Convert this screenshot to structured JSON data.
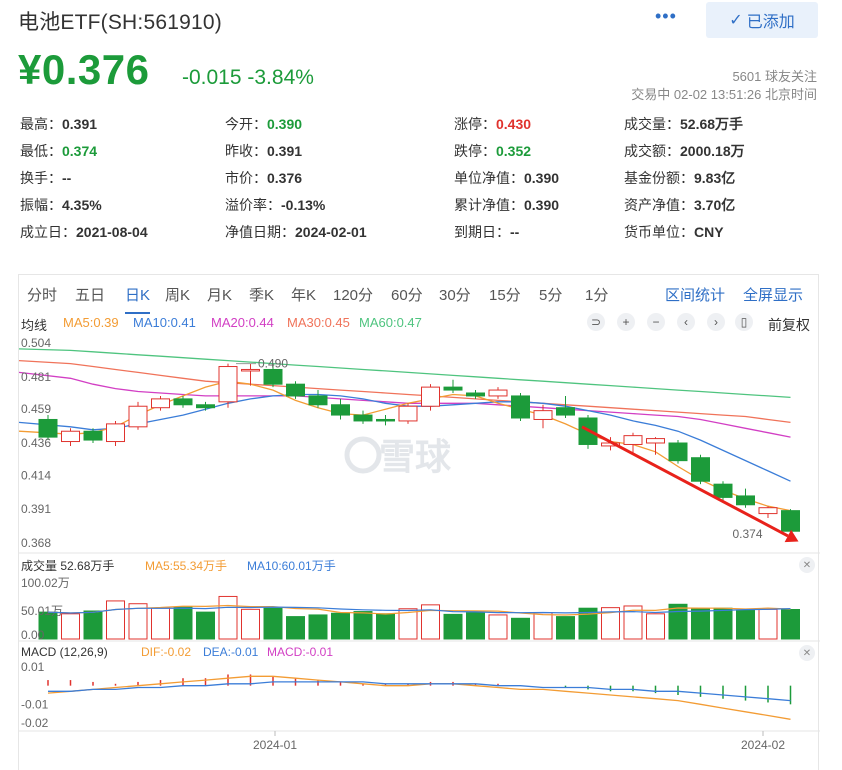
{
  "header": {
    "title": "电池ETF(SH:561910)",
    "more": "•••",
    "follow_label": "已添加",
    "price": "¥0.376",
    "change": "-0.015  -3.84%",
    "followers": "5601 球友关注",
    "status": "交易中 02-02 13:51:26 北京时间"
  },
  "stats": [
    [
      {
        "label": "最高：",
        "value": "0.391",
        "color": ""
      },
      {
        "label": "今开：",
        "value": "0.390",
        "color": "green"
      },
      {
        "label": "涨停：",
        "value": "0.430",
        "color": "red"
      },
      {
        "label": "成交量：",
        "value": "52.68万手",
        "color": ""
      }
    ],
    [
      {
        "label": "最低：",
        "value": "0.374",
        "color": "green"
      },
      {
        "label": "昨收：",
        "value": "0.391",
        "color": ""
      },
      {
        "label": "跌停：",
        "value": "0.352",
        "color": "green"
      },
      {
        "label": "成交额：",
        "value": "2000.18万",
        "color": ""
      }
    ],
    [
      {
        "label": "换手：",
        "value": "--",
        "color": ""
      },
      {
        "label": "市价：",
        "value": "0.376",
        "color": ""
      },
      {
        "label": "单位净值：",
        "value": "0.390",
        "color": ""
      },
      {
        "label": "基金份额：",
        "value": "9.83亿",
        "color": ""
      }
    ],
    [
      {
        "label": "振幅：",
        "value": "4.35%",
        "color": ""
      },
      {
        "label": "溢价率：",
        "value": "-0.13%",
        "color": ""
      },
      {
        "label": "累计净值：",
        "value": "0.390",
        "color": ""
      },
      {
        "label": "资产净值：",
        "value": "3.70亿",
        "color": ""
      }
    ],
    [
      {
        "label": "成立日：",
        "value": "2021-08-04",
        "color": ""
      },
      {
        "label": "净值日期：",
        "value": "2024-02-01",
        "color": ""
      },
      {
        "label": "到期日：",
        "value": "--",
        "color": ""
      },
      {
        "label": "货币单位：",
        "value": "CNY",
        "color": ""
      }
    ]
  ],
  "tabs": [
    "分时",
    "五日",
    "日K",
    "周K",
    "月K",
    "季K",
    "年K",
    "120分",
    "60分",
    "30分",
    "15分",
    "5分",
    "1分"
  ],
  "tab_right": [
    "区间统计",
    "全屏显示"
  ],
  "ma_legend": {
    "label": "均线",
    "items": [
      {
        "text": "MA5:0.39",
        "color": "#f39c34"
      },
      {
        "text": "MA10:0.41",
        "color": "#3b7dd8"
      },
      {
        "text": "MA20:0.44",
        "color": "#d23fc4"
      },
      {
        "text": "MA30:0.45",
        "color": "#f0735a"
      },
      {
        "text": "MA60:0.47",
        "color": "#4fc47f"
      }
    ],
    "controls": [
      "⊃",
      "+",
      "−",
      "‹",
      "›",
      "▯"
    ],
    "fq": "前复权"
  },
  "watermark": "雪球",
  "volume_legend": {
    "label": "成交量 52.68万手",
    "ma5": "MA5:55.34万手",
    "ma10": "MA10:60.01万手",
    "top_tick": "100.02万",
    "mid_tick": "50.01万",
    "zero_tick": "0.00"
  },
  "macd_legend": {
    "label": "MACD (12,26,9)",
    "dif": "DIF:-0.02",
    "dea": "DEA:-0.01",
    "macd": "MACD:-0.01",
    "ticks": [
      "0.01",
      "-0.01",
      "-0.02"
    ]
  },
  "colors": {
    "up": "#e0332e",
    "down": "#1c9b3a",
    "arrow": "#e8221b"
  },
  "chart_data": {
    "type": "candlestick",
    "price_axis": {
      "ticks": [
        "0.504",
        "0.481",
        "0.459",
        "0.436",
        "0.414",
        "0.391",
        "0.368"
      ],
      "ylim": [
        0.368,
        0.504
      ]
    },
    "annotations": {
      "high": "0.490",
      "low": "0.374"
    },
    "x_labels": [
      "2024-01",
      "2024-02"
    ],
    "candles": [
      {
        "o": 0.452,
        "c": 0.44,
        "h": 0.455,
        "l": 0.438
      },
      {
        "o": 0.437,
        "c": 0.444,
        "h": 0.446,
        "l": 0.434
      },
      {
        "o": 0.444,
        "c": 0.438,
        "h": 0.446,
        "l": 0.436
      },
      {
        "o": 0.437,
        "c": 0.449,
        "h": 0.451,
        "l": 0.434
      },
      {
        "o": 0.447,
        "c": 0.461,
        "h": 0.464,
        "l": 0.445
      },
      {
        "o": 0.46,
        "c": 0.466,
        "h": 0.468,
        "l": 0.458
      },
      {
        "o": 0.466,
        "c": 0.462,
        "h": 0.468,
        "l": 0.46
      },
      {
        "o": 0.462,
        "c": 0.46,
        "h": 0.464,
        "l": 0.458
      },
      {
        "o": 0.464,
        "c": 0.488,
        "h": 0.49,
        "l": 0.46
      },
      {
        "o": 0.485,
        "c": 0.486,
        "h": 0.49,
        "l": 0.475
      },
      {
        "o": 0.486,
        "c": 0.476,
        "h": 0.49,
        "l": 0.474
      },
      {
        "o": 0.476,
        "c": 0.468,
        "h": 0.478,
        "l": 0.466
      },
      {
        "o": 0.468,
        "c": 0.462,
        "h": 0.472,
        "l": 0.46
      },
      {
        "o": 0.462,
        "c": 0.455,
        "h": 0.466,
        "l": 0.452
      },
      {
        "o": 0.455,
        "c": 0.451,
        "h": 0.458,
        "l": 0.449
      },
      {
        "o": 0.452,
        "c": 0.451,
        "h": 0.455,
        "l": 0.448
      },
      {
        "o": 0.451,
        "c": 0.461,
        "h": 0.463,
        "l": 0.449
      },
      {
        "o": 0.461,
        "c": 0.474,
        "h": 0.476,
        "l": 0.458
      },
      {
        "o": 0.474,
        "c": 0.472,
        "h": 0.479,
        "l": 0.47
      },
      {
        "o": 0.47,
        "c": 0.468,
        "h": 0.472,
        "l": 0.466
      },
      {
        "o": 0.468,
        "c": 0.472,
        "h": 0.474,
        "l": 0.466
      },
      {
        "o": 0.468,
        "c": 0.453,
        "h": 0.47,
        "l": 0.451
      },
      {
        "o": 0.452,
        "c": 0.458,
        "h": 0.462,
        "l": 0.446
      },
      {
        "o": 0.46,
        "c": 0.455,
        "h": 0.468,
        "l": 0.453
      },
      {
        "o": 0.453,
        "c": 0.435,
        "h": 0.455,
        "l": 0.432
      },
      {
        "o": 0.434,
        "c": 0.436,
        "h": 0.44,
        "l": 0.431
      },
      {
        "o": 0.435,
        "c": 0.441,
        "h": 0.443,
        "l": 0.429
      },
      {
        "o": 0.436,
        "c": 0.439,
        "h": 0.44,
        "l": 0.428
      },
      {
        "o": 0.436,
        "c": 0.424,
        "h": 0.438,
        "l": 0.422
      },
      {
        "o": 0.426,
        "c": 0.41,
        "h": 0.428,
        "l": 0.408
      },
      {
        "o": 0.408,
        "c": 0.399,
        "h": 0.41,
        "l": 0.397
      },
      {
        "o": 0.4,
        "c": 0.394,
        "h": 0.405,
        "l": 0.392
      },
      {
        "o": 0.388,
        "c": 0.392,
        "h": 0.393,
        "l": 0.385
      },
      {
        "o": 0.39,
        "c": 0.376,
        "h": 0.391,
        "l": 0.374
      }
    ],
    "volume": [
      48,
      45,
      50,
      68,
      63,
      55,
      57,
      48,
      76,
      53,
      55,
      40,
      43,
      46,
      49,
      45,
      54,
      61,
      44,
      47,
      43,
      37,
      47,
      40,
      55,
      56,
      59,
      45,
      62,
      54,
      55,
      52,
      53,
      52.68
    ],
    "macd_hist": [
      0.003,
      0.003,
      0.002,
      0.001,
      0.002,
      0.003,
      0.004,
      0.004,
      0.006,
      0.006,
      0.005,
      0.004,
      0.003,
      0.002,
      0.001,
      0.001,
      0.001,
      0.002,
      0.002,
      0.001,
      0.001,
      0.0,
      0.0,
      -0.001,
      -0.002,
      -0.003,
      -0.003,
      -0.004,
      -0.005,
      -0.006,
      -0.007,
      -0.008,
      -0.009,
      -0.01
    ],
    "dif": [
      -0.004,
      -0.003,
      -0.002,
      -0.001,
      0.0,
      0.001,
      0.002,
      0.003,
      0.004,
      0.005,
      0.005,
      0.004,
      0.003,
      0.002,
      0.001,
      0.0,
      0.0,
      0.001,
      0.001,
      0.0,
      -0.001,
      -0.002,
      -0.002,
      -0.003,
      -0.004,
      -0.005,
      -0.006,
      -0.007,
      -0.008,
      -0.01,
      -0.012,
      -0.014,
      -0.016,
      -0.018
    ],
    "dea": [
      -0.003,
      -0.003,
      -0.002,
      -0.002,
      -0.001,
      -0.001,
      0.0,
      0.0,
      0.001,
      0.001,
      0.002,
      0.002,
      0.002,
      0.002,
      0.002,
      0.001,
      0.001,
      0.001,
      0.001,
      0.001,
      0.0,
      0.0,
      -0.001,
      -0.001,
      -0.001,
      -0.002,
      -0.002,
      -0.003,
      -0.003,
      -0.004,
      -0.005,
      -0.006,
      -0.007,
      -0.008
    ],
    "ma_lines": {
      "MA60": [
        0.5,
        0.499,
        0.498,
        0.497,
        0.496,
        0.495,
        0.494,
        0.493,
        0.492,
        0.491,
        0.49,
        0.489,
        0.488,
        0.487,
        0.486,
        0.485,
        0.484,
        0.483,
        0.482,
        0.481,
        0.48,
        0.479,
        0.478,
        0.477,
        0.476,
        0.475,
        0.474,
        0.473,
        0.472,
        0.471,
        0.47,
        0.469,
        0.468,
        0.467
      ],
      "MA30": [
        0.492,
        0.49,
        0.488,
        0.486,
        0.484,
        0.482,
        0.48,
        0.478,
        0.477,
        0.476,
        0.475,
        0.474,
        0.473,
        0.472,
        0.471,
        0.47,
        0.469,
        0.468,
        0.467,
        0.466,
        0.465,
        0.464,
        0.463,
        0.462,
        0.461,
        0.46,
        0.459,
        0.458,
        0.457,
        0.456,
        0.455,
        0.454,
        0.452,
        0.45
      ],
      "MA20": [
        0.484,
        0.48,
        0.476,
        0.473,
        0.471,
        0.47,
        0.469,
        0.468,
        0.468,
        0.468,
        0.468,
        0.468,
        0.467,
        0.466,
        0.465,
        0.464,
        0.463,
        0.463,
        0.463,
        0.463,
        0.462,
        0.461,
        0.46,
        0.459,
        0.458,
        0.457,
        0.456,
        0.455,
        0.454,
        0.452,
        0.449,
        0.446,
        0.443,
        0.44
      ],
      "MA10": [
        0.45,
        0.447,
        0.445,
        0.446,
        0.449,
        0.452,
        0.455,
        0.459,
        0.463,
        0.466,
        0.468,
        0.469,
        0.469,
        0.468,
        0.466,
        0.463,
        0.461,
        0.461,
        0.462,
        0.463,
        0.464,
        0.464,
        0.463,
        0.461,
        0.458,
        0.455,
        0.451,
        0.448,
        0.444,
        0.438,
        0.431,
        0.424,
        0.417,
        0.41
      ],
      "MA5": [
        0.444,
        0.442,
        0.443,
        0.447,
        0.455,
        0.462,
        0.468,
        0.474,
        0.478,
        0.476,
        0.472,
        0.465,
        0.46,
        0.456,
        0.455,
        0.459,
        0.463,
        0.466,
        0.469,
        0.468,
        0.463,
        0.459,
        0.455,
        0.449,
        0.442,
        0.437,
        0.435,
        0.43,
        0.42,
        0.411,
        0.404,
        0.398,
        0.393,
        0.39
      ]
    }
  }
}
